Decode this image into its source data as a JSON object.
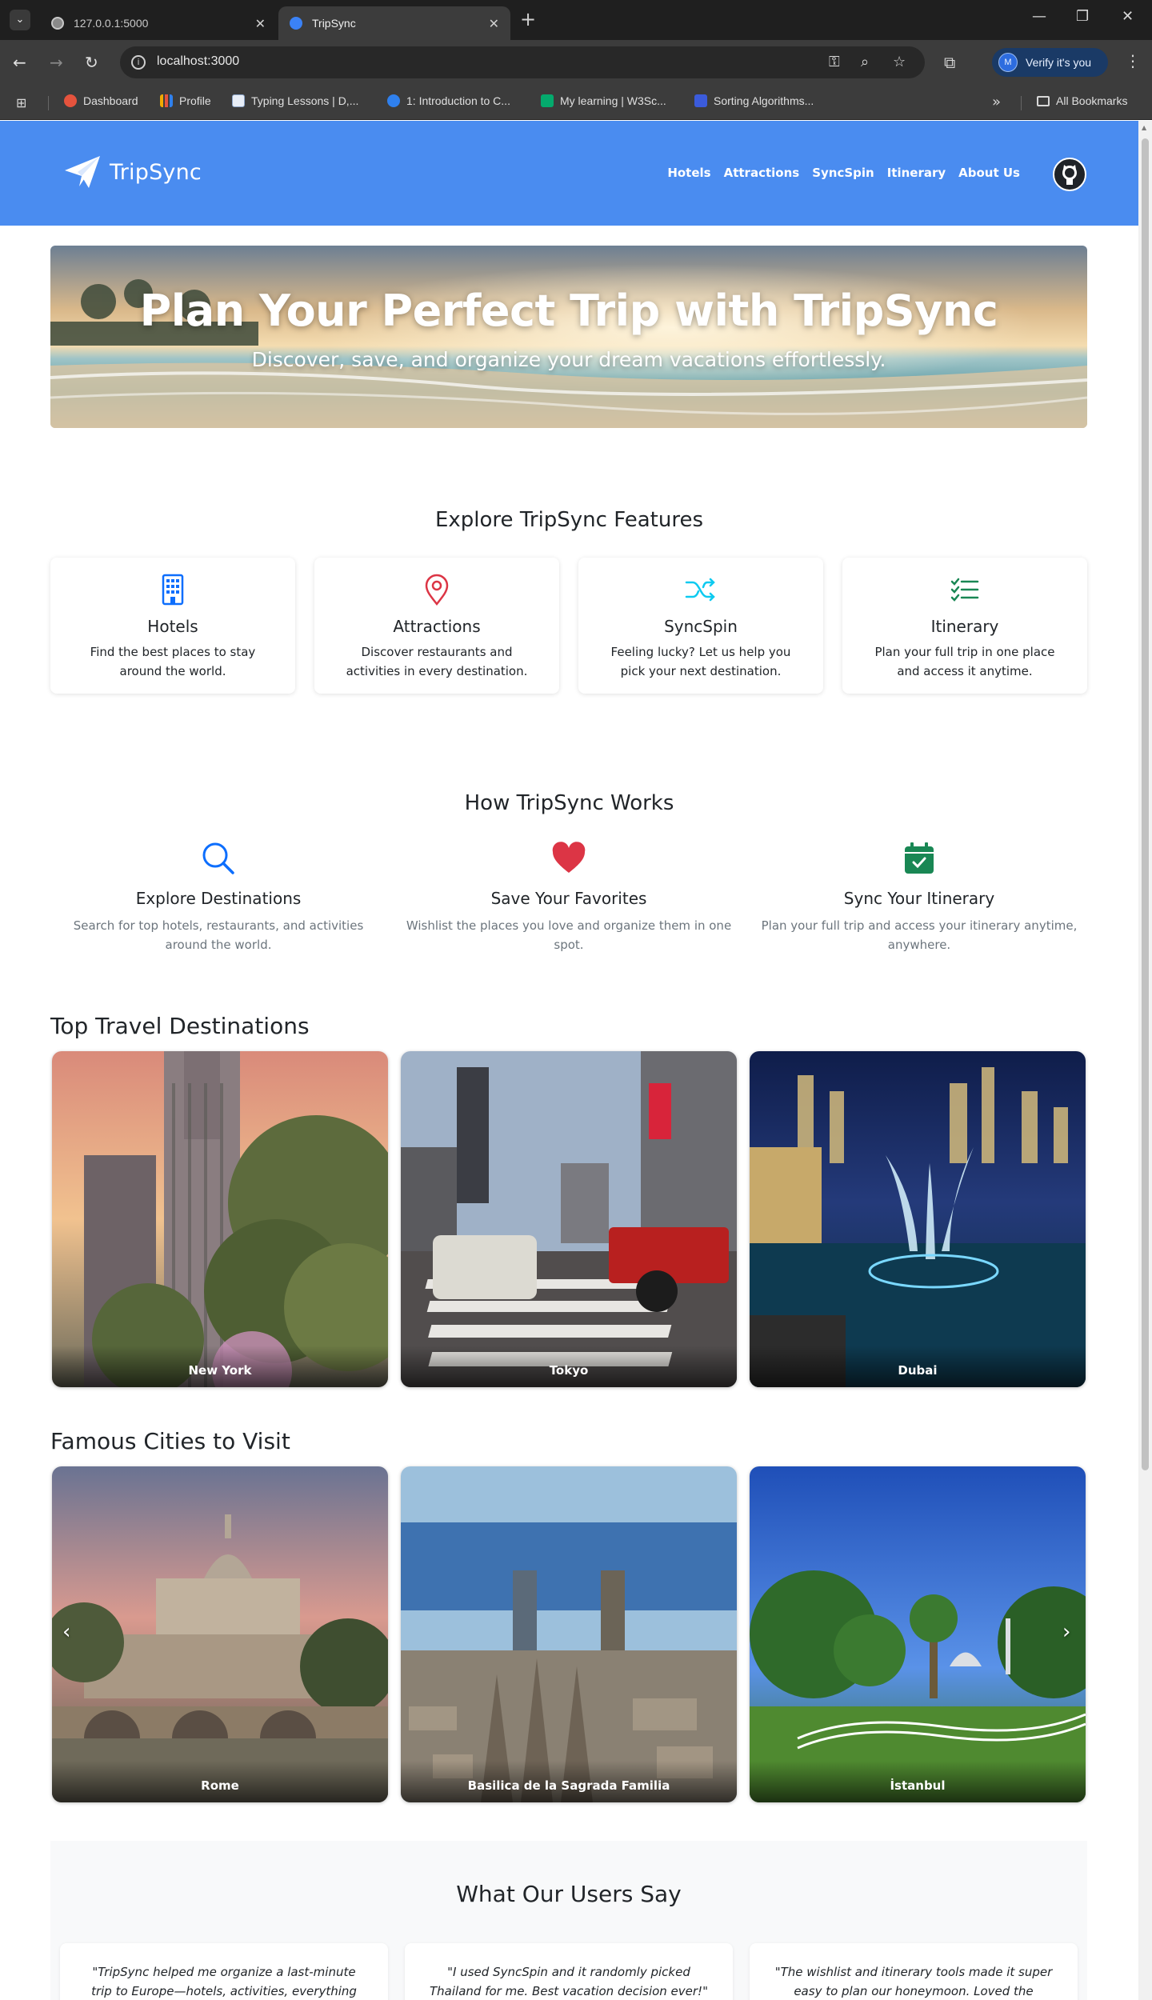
{
  "browser": {
    "tabs": [
      {
        "label": "127.0.0.1:5000"
      },
      {
        "label": "TripSync"
      }
    ],
    "url": "localhost:3000",
    "profile_button": "Verify it's you",
    "profile_initial": "M",
    "bookmarks": [
      {
        "label": "Dashboard",
        "icon": "dashboard-favicon",
        "color": "#e5533d"
      },
      {
        "label": "Profile",
        "icon": "bar-chart-favicon",
        "color": "#f2a900"
      },
      {
        "label": "Typing Lessons | D,...",
        "icon": "typing-favicon",
        "color": "#8aa4c8"
      },
      {
        "label": "1: Introduction to C...",
        "icon": "p-favicon",
        "color": "#2f80ed"
      },
      {
        "label": "My learning | W3Sc...",
        "icon": "w3-favicon",
        "color": "#04aa6d"
      },
      {
        "label": "Sorting Algorithms...",
        "icon": "sort-favicon",
        "color": "#3b5bdb"
      }
    ],
    "all_bookmarks": "All Bookmarks"
  },
  "site": {
    "brand": "TripSync",
    "nav": [
      "Hotels",
      "Attractions",
      "SyncSpin",
      "Itinerary",
      "About Us"
    ],
    "hero": {
      "title": "Plan Your Perfect Trip with TripSync",
      "subtitle": "Discover, save, and organize your dream vacations effortlessly."
    },
    "features_title": "Explore TripSync Features",
    "features": [
      {
        "name": "Hotels",
        "desc": "Find the best places to stay around the world.",
        "icon": "building-icon",
        "color": "#0d6efd"
      },
      {
        "name": "Attractions",
        "desc": "Discover restaurants and activities in every destination.",
        "icon": "map-pin-icon",
        "color": "#dc3545"
      },
      {
        "name": "SyncSpin",
        "desc": "Feeling lucky? Let us help you pick your next destination.",
        "icon": "shuffle-icon",
        "color": "#0dcaf0"
      },
      {
        "name": "Itinerary",
        "desc": "Plan your full trip in one place and access it anytime.",
        "icon": "checklist-icon",
        "color": "#198754"
      }
    ],
    "how_title": "How TripSync Works",
    "steps": [
      {
        "name": "Explore Destinations",
        "desc": "Search for top hotels, restaurants, and activities around the world.",
        "icon": "search-icon",
        "color": "#0d6efd"
      },
      {
        "name": "Save Your Favorites",
        "desc": "Wishlist the places you love and organize them in one spot.",
        "icon": "heart-icon",
        "color": "#dc3545"
      },
      {
        "name": "Sync Your Itinerary",
        "desc": "Plan your full trip and access your itinerary anytime, anywhere.",
        "icon": "calendar-check-icon",
        "color": "#198754"
      }
    ],
    "top_title": "Top Travel Destinations",
    "top_destinations": [
      "New York",
      "Tokyo",
      "Dubai"
    ],
    "cities_title": "Famous Cities to Visit",
    "cities": [
      "Rome",
      "Basilica de la Sagrada Familia",
      "İstanbul"
    ],
    "testimonials_title": "What Our Users Say",
    "testimonials": [
      "\"TripSync helped me organize a last-minute trip to Europe—hotels, activities, everything was in one",
      "\"I used SyncSpin and it randomly picked Thailand for me. Best vacation decision ever!\"",
      "\"The wishlist and itinerary tools made it super easy to plan our honeymoon. Loved the interface!\""
    ],
    "accent_color": "#4a8cf0"
  }
}
